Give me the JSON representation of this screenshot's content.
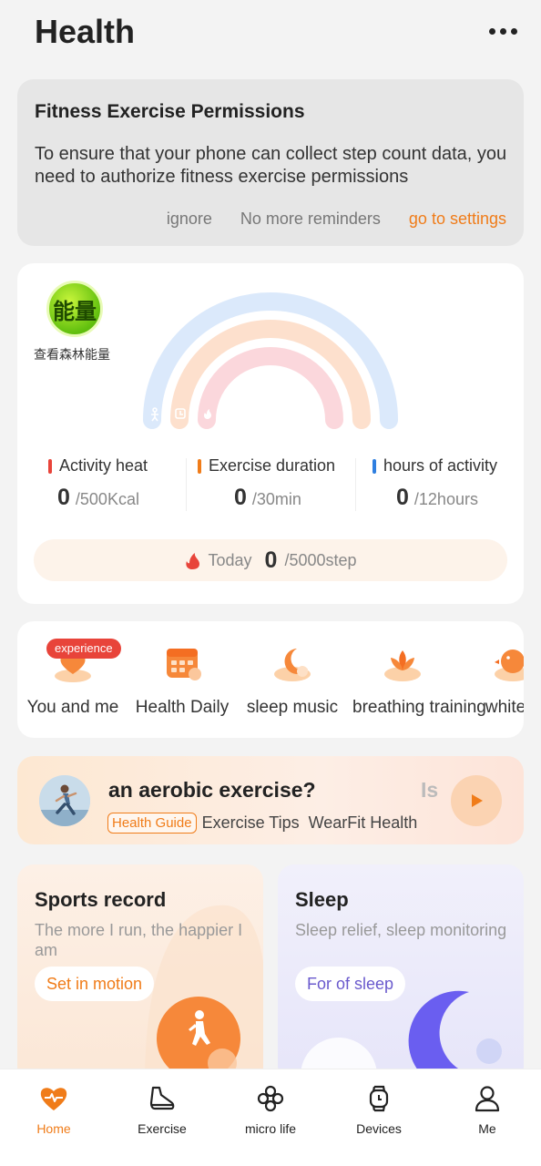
{
  "header": {
    "title": "Health",
    "more_icon": "more-horizontal-icon"
  },
  "permissions": {
    "title": "Fitness Exercise Permissions",
    "description": "To ensure that your phone can collect step count data, you need to authorize fitness exercise permissions",
    "ignore": "ignore",
    "no_reminders": "No more reminders",
    "go_settings": "go to settings",
    "accent": "#f07c19"
  },
  "energy": {
    "badge_text": "能量",
    "badge_label": "查看森林能量",
    "stats": [
      {
        "label": "Activity heat",
        "value": "0",
        "unit": "/500Kcal",
        "color": "#e8443a"
      },
      {
        "label": "Exercise duration",
        "value": "0",
        "unit": "/30min",
        "color": "#f07c19"
      },
      {
        "label": "hours of activity",
        "value": "0",
        "unit": "/12hours",
        "color": "#2f7fe0"
      }
    ],
    "today": {
      "label": "Today",
      "value": "0",
      "unit": "/5000step"
    }
  },
  "quick_access": {
    "badge": "experience",
    "items": [
      {
        "label": "You and me",
        "icon": "heart-hands-icon"
      },
      {
        "label": "Health Daily",
        "icon": "calendar-icon"
      },
      {
        "label": "sleep music",
        "icon": "moon-music-icon"
      },
      {
        "label": "breathing training",
        "icon": "lotus-icon"
      },
      {
        "label": "white n",
        "icon": "bird-icon"
      }
    ]
  },
  "guide": {
    "headline": "an aerobic exercise?",
    "headline_next": "Is",
    "tag": "Health Guide",
    "category": "Exercise Tips",
    "source": "WearFit Health"
  },
  "sports_card": {
    "title": "Sports record",
    "subtitle": "The more I run, the happier I am",
    "button": "Set in motion"
  },
  "sleep_card": {
    "title": "Sleep",
    "subtitle": "Sleep relief, sleep monitoring",
    "button": "For of sleep"
  },
  "tabbar": {
    "items": [
      {
        "label": "Home",
        "icon": "heart-pulse-icon",
        "active": true
      },
      {
        "label": "Exercise",
        "icon": "sneaker-icon",
        "active": false
      },
      {
        "label": "micro life",
        "icon": "clover-icon",
        "active": false
      },
      {
        "label": "Devices",
        "icon": "watch-icon",
        "active": false
      },
      {
        "label": "Me",
        "icon": "person-icon",
        "active": false
      }
    ]
  }
}
